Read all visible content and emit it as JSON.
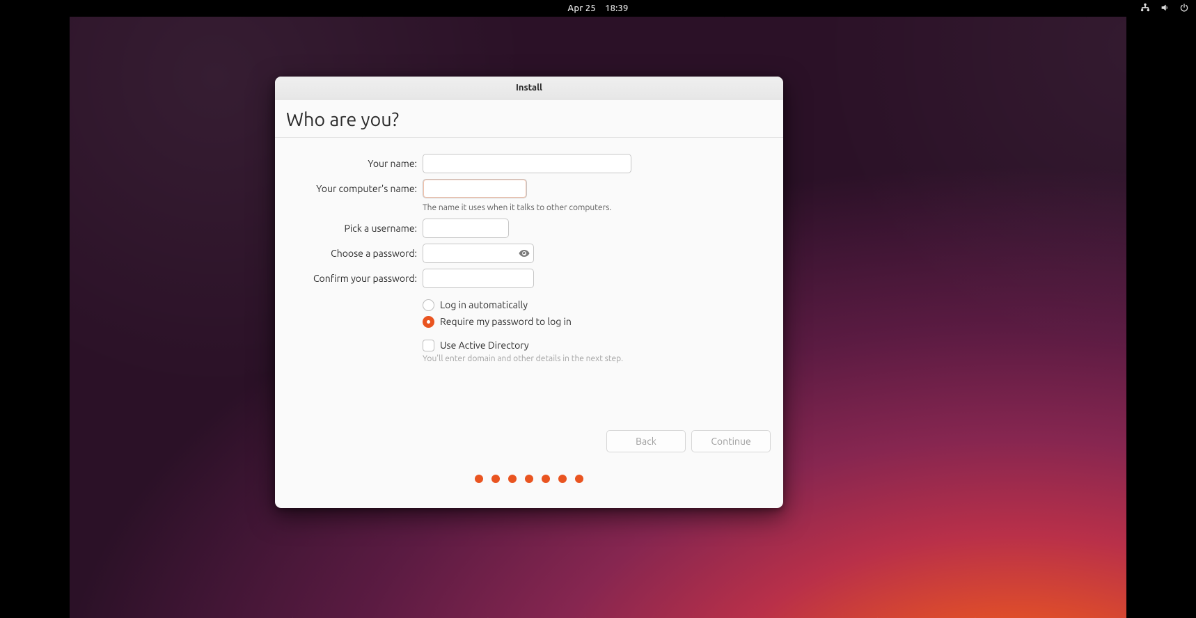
{
  "topbar": {
    "date": "Apr 25",
    "time": "18:39"
  },
  "window": {
    "title": "Install",
    "heading": "Who are you?"
  },
  "labels": {
    "name": "Your name:",
    "host": "Your computer's name:",
    "user": "Pick a username:",
    "pass": "Choose a password:",
    "confirm": "Confirm your password:"
  },
  "values": {
    "name": "",
    "host": "",
    "user": "",
    "pass": "",
    "confirm": ""
  },
  "hints": {
    "host": "The name it uses when it talks to other computers.",
    "ad": "You'll enter domain and other details in the next step."
  },
  "options": {
    "auto": "Log in automatically",
    "require": "Require my password to log in",
    "ad": "Use Active Directory"
  },
  "buttons": {
    "back": "Back",
    "continue": "Continue"
  },
  "pager_dots": 7
}
